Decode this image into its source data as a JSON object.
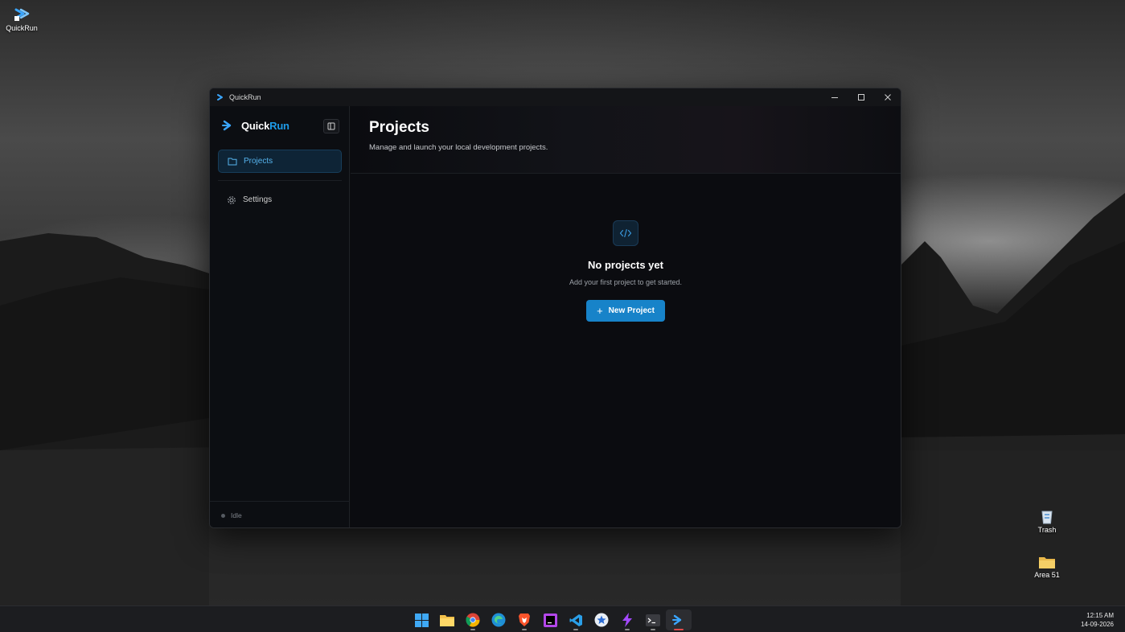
{
  "desktop": {
    "icons": [
      {
        "label": "QuickRun",
        "icon": "quickrun-arrow-icon"
      },
      {
        "label": "Trash",
        "icon": "recycle-bin-icon"
      },
      {
        "label": "Area 51",
        "icon": "folder-icon"
      }
    ]
  },
  "window": {
    "title": "QuickRun",
    "controls": {
      "minimize": "minimize-icon",
      "maximize": "maximize-icon",
      "close": "close-icon"
    }
  },
  "sidebar": {
    "brand_part1": "Quick",
    "brand_part2": "Run",
    "items": [
      {
        "label": "Projects",
        "icon": "folder-icon",
        "active": true
      },
      {
        "label": "Settings",
        "icon": "gear-icon",
        "active": false
      }
    ],
    "status": "Idle"
  },
  "main": {
    "title": "Projects",
    "subtitle": "Manage and launch your local development projects.",
    "empty_state": {
      "icon": "code-icon",
      "title": "No projects yet",
      "subtitle": "Add your first project to get started.",
      "button_label": "New Project"
    }
  },
  "taskbar": {
    "apps": [
      "start",
      "file-explorer",
      "chrome",
      "edge",
      "brave",
      "jetbrains",
      "vscode",
      "app-store",
      "bolt",
      "terminal",
      "quickrun"
    ],
    "time": "12:15 AM",
    "date": "14-09-2026"
  },
  "colors": {
    "accent": "#1e9be8",
    "button": "#1783c9",
    "window_bg": "#0c0d10"
  }
}
